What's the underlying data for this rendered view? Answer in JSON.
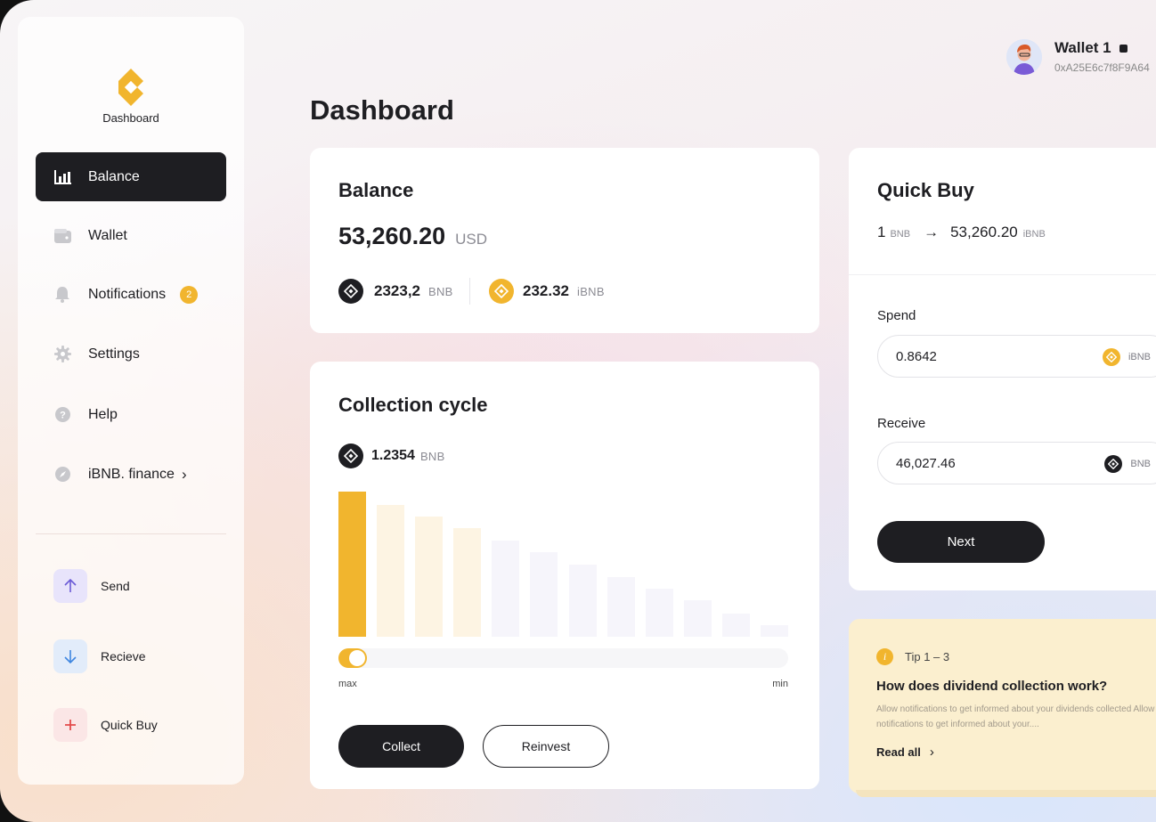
{
  "sidebar": {
    "logo_label": "Dashboard",
    "items": [
      {
        "label": "Balance"
      },
      {
        "label": "Wallet"
      },
      {
        "label": "Notifications",
        "badge": "2"
      },
      {
        "label": "Settings"
      },
      {
        "label": "Help"
      },
      {
        "label": "iBNB. finance",
        "chevron": "›"
      }
    ],
    "actions": [
      {
        "label": "Send",
        "icon": "arrow-up-icon"
      },
      {
        "label": "Recieve",
        "icon": "arrow-down-icon"
      },
      {
        "label": "Quick Buy",
        "icon": "plus-icon"
      }
    ]
  },
  "header": {
    "title": "Dashboard",
    "wallet_name": "Wallet 1",
    "wallet_address": "0xA25E6c7f8F9A64"
  },
  "balance": {
    "title": "Balance",
    "total": "53,260.20",
    "currency": "USD",
    "assets": [
      {
        "amount": "2323,2",
        "unit": "BNB"
      },
      {
        "amount": "232.32",
        "unit": "iBNB"
      }
    ]
  },
  "collection": {
    "title": "Collection cycle",
    "amount": "1.2354",
    "unit": "BNB",
    "slider_min_label": "max",
    "slider_max_label": "min",
    "slider_value": 0.04,
    "collect_label": "Collect",
    "reinvest_label": "Reinvest"
  },
  "chart_data": {
    "type": "bar",
    "title": "",
    "values": [
      100,
      91,
      83,
      75,
      66,
      58,
      50,
      41,
      33,
      25,
      16,
      8
    ],
    "highlighted_index": 0
  },
  "quick_buy": {
    "title": "Quick Buy",
    "rate_left_amount": "1",
    "rate_left_unit": "BNB",
    "rate_right_amount": "53,260.20",
    "rate_right_unit": "iBNB",
    "spend_label": "Spend",
    "spend_value": "0.8642",
    "spend_unit": "iBNB",
    "receive_label": "Receive",
    "receive_value": "46,027.46",
    "receive_unit": "BNB",
    "next_label": "Next"
  },
  "tip": {
    "counter": "Tip 1 – 3",
    "title": "How does dividend collection work?",
    "body": "Allow  notifications to get informed about your dividends collected Allow  notifications to get informed about your....",
    "read_all": "Read all"
  },
  "colors": {
    "accent": "#f1b52e",
    "dark": "#1e1e22"
  }
}
